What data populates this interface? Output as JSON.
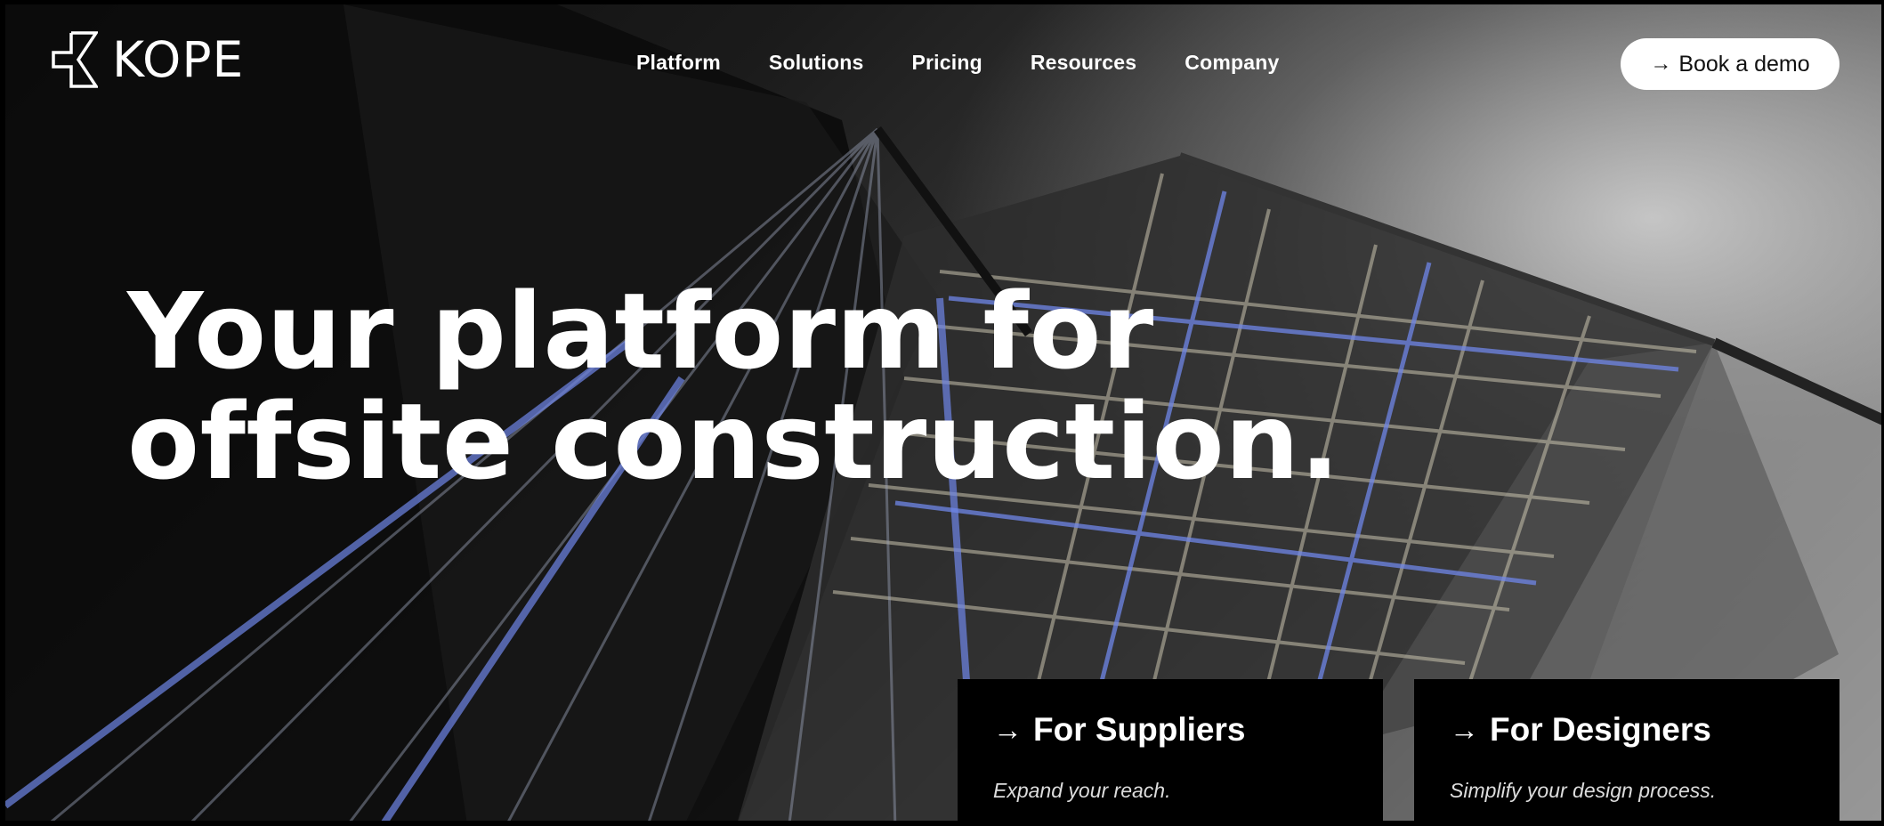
{
  "brand": {
    "name": "KOPE",
    "logo_icon": "kope-logo-icon"
  },
  "nav": {
    "items": [
      {
        "label": "Platform"
      },
      {
        "label": "Solutions"
      },
      {
        "label": "Pricing"
      },
      {
        "label": "Resources"
      },
      {
        "label": "Company"
      }
    ]
  },
  "cta": {
    "arrow": "→",
    "label": "Book a demo"
  },
  "hero": {
    "headline_line1": "Your platform for",
    "headline_line2": "offsite construction."
  },
  "cards": [
    {
      "arrow": "→",
      "title": "For Suppliers",
      "subtitle": "Expand your reach."
    },
    {
      "arrow": "→",
      "title": "For Designers",
      "subtitle": "Simplify your design process."
    }
  ],
  "colors": {
    "accent_blue": "#6f86e8",
    "card_bg": "#000000",
    "button_bg": "#ffffff"
  }
}
